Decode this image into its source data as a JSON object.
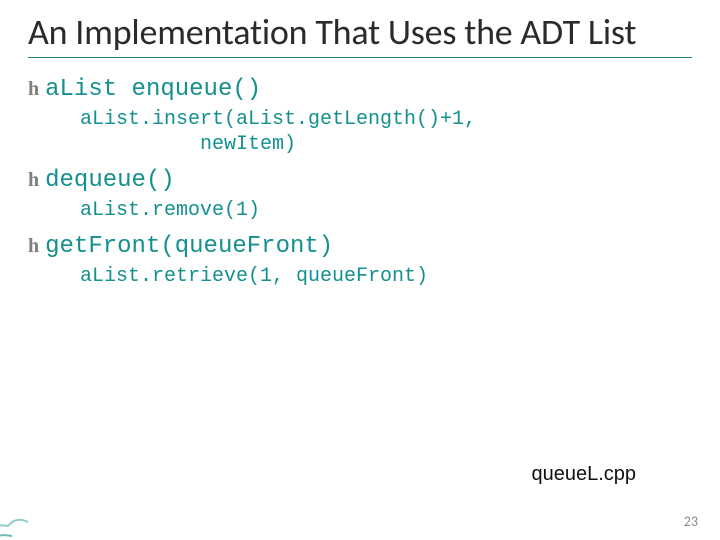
{
  "title": "An Implementation That Uses the ADT List",
  "items": [
    {
      "head": "aList enqueue()",
      "sub": "aList.insert(aList.getLength()+1,\n          newItem)"
    },
    {
      "head": "dequeue()",
      "sub": "aList.remove(1)"
    },
    {
      "head": "getFront(queueFront)",
      "sub": "aList.retrieve(1, queueFront)"
    }
  ],
  "footer_label": "queueL.cpp",
  "page_number": "23",
  "bullet_glyph": "h"
}
